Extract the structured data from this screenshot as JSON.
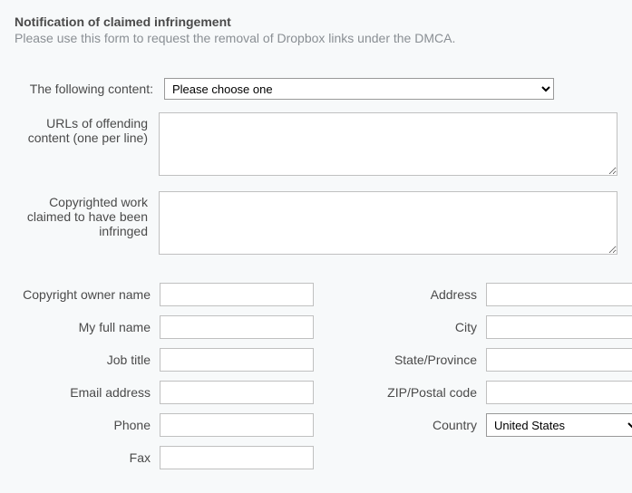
{
  "header": {
    "title": "Notification of claimed infringement",
    "subtitle": "Please use this form to request the removal of Dropbox links under the DMCA."
  },
  "labels": {
    "following_content": "The following content:",
    "urls": "URLs of offending content (one per line)",
    "copyrighted_work": "Copyrighted work claimed to have been infringed",
    "owner_name": "Copyright owner name",
    "full_name": "My full name",
    "job_title": "Job title",
    "email": "Email address",
    "phone": "Phone",
    "fax": "Fax",
    "address": "Address",
    "city": "City",
    "state": "State/Province",
    "zip": "ZIP/Postal code",
    "country": "Country"
  },
  "values": {
    "content_select": "Please choose one",
    "urls": "",
    "copyrighted_work": "",
    "owner_name": "",
    "full_name": "",
    "job_title": "",
    "email": "",
    "phone": "",
    "fax": "",
    "address": "",
    "city": "",
    "state": "",
    "zip": "",
    "country": "United States"
  }
}
